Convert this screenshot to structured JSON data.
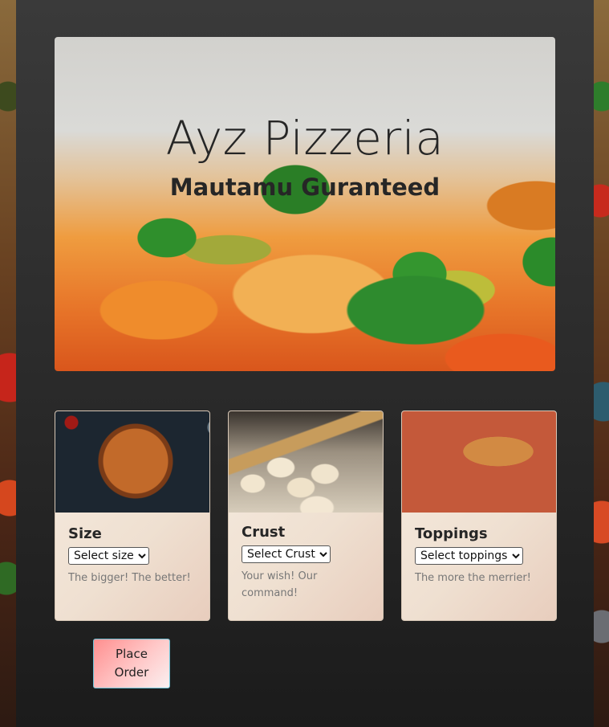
{
  "hero": {
    "title": "Ayz Pizzeria",
    "subtitle": "Mautamu Guranteed"
  },
  "cards": [
    {
      "title": "Size",
      "select_value": "Select size",
      "text": "The bigger! The better!"
    },
    {
      "title": "Crust",
      "select_value": "Select Crust",
      "text": "Your wish! Our command!"
    },
    {
      "title": "Toppings",
      "select_value": "Select toppings",
      "text": "The more the merrier!"
    }
  ],
  "order_button": {
    "label": "Place Order"
  }
}
